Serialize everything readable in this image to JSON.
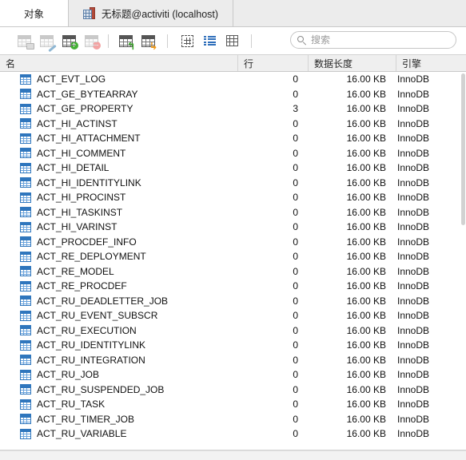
{
  "tabs": [
    {
      "label": "对象",
      "icon": "",
      "active": true
    },
    {
      "label": "无标题@activiti (localhost)",
      "icon": "database-icon",
      "active": false
    }
  ],
  "toolbar": {
    "buttons": [
      {
        "name": "open-table-button",
        "title": "打开表"
      },
      {
        "name": "design-table-button",
        "title": "设计表"
      },
      {
        "name": "new-table-button",
        "title": "新建表"
      },
      {
        "name": "delete-table-button",
        "title": "删除表"
      },
      {
        "name": "import-wizard-button",
        "title": "导入向导"
      },
      {
        "name": "export-wizard-button",
        "title": "导出向导"
      },
      {
        "name": "select-grid-button",
        "title": "网格"
      },
      {
        "name": "list-view-button",
        "title": "列表"
      },
      {
        "name": "detail-view-button",
        "title": "详细信息"
      }
    ]
  },
  "search": {
    "placeholder": "搜索",
    "value": ""
  },
  "table": {
    "columns": [
      {
        "key": "name",
        "label": "名"
      },
      {
        "key": "rows",
        "label": "行"
      },
      {
        "key": "length",
        "label": "数据长度"
      },
      {
        "key": "engine",
        "label": "引擎"
      }
    ],
    "rows": [
      {
        "name": "ACT_EVT_LOG",
        "rows": "0",
        "length": "16.00 KB",
        "engine": "InnoDB"
      },
      {
        "name": "ACT_GE_BYTEARRAY",
        "rows": "0",
        "length": "16.00 KB",
        "engine": "InnoDB"
      },
      {
        "name": "ACT_GE_PROPERTY",
        "rows": "3",
        "length": "16.00 KB",
        "engine": "InnoDB"
      },
      {
        "name": "ACT_HI_ACTINST",
        "rows": "0",
        "length": "16.00 KB",
        "engine": "InnoDB"
      },
      {
        "name": "ACT_HI_ATTACHMENT",
        "rows": "0",
        "length": "16.00 KB",
        "engine": "InnoDB"
      },
      {
        "name": "ACT_HI_COMMENT",
        "rows": "0",
        "length": "16.00 KB",
        "engine": "InnoDB"
      },
      {
        "name": "ACT_HI_DETAIL",
        "rows": "0",
        "length": "16.00 KB",
        "engine": "InnoDB"
      },
      {
        "name": "ACT_HI_IDENTITYLINK",
        "rows": "0",
        "length": "16.00 KB",
        "engine": "InnoDB"
      },
      {
        "name": "ACT_HI_PROCINST",
        "rows": "0",
        "length": "16.00 KB",
        "engine": "InnoDB"
      },
      {
        "name": "ACT_HI_TASKINST",
        "rows": "0",
        "length": "16.00 KB",
        "engine": "InnoDB"
      },
      {
        "name": "ACT_HI_VARINST",
        "rows": "0",
        "length": "16.00 KB",
        "engine": "InnoDB"
      },
      {
        "name": "ACT_PROCDEF_INFO",
        "rows": "0",
        "length": "16.00 KB",
        "engine": "InnoDB"
      },
      {
        "name": "ACT_RE_DEPLOYMENT",
        "rows": "0",
        "length": "16.00 KB",
        "engine": "InnoDB"
      },
      {
        "name": "ACT_RE_MODEL",
        "rows": "0",
        "length": "16.00 KB",
        "engine": "InnoDB"
      },
      {
        "name": "ACT_RE_PROCDEF",
        "rows": "0",
        "length": "16.00 KB",
        "engine": "InnoDB"
      },
      {
        "name": "ACT_RU_DEADLETTER_JOB",
        "rows": "0",
        "length": "16.00 KB",
        "engine": "InnoDB"
      },
      {
        "name": "ACT_RU_EVENT_SUBSCR",
        "rows": "0",
        "length": "16.00 KB",
        "engine": "InnoDB"
      },
      {
        "name": "ACT_RU_EXECUTION",
        "rows": "0",
        "length": "16.00 KB",
        "engine": "InnoDB"
      },
      {
        "name": "ACT_RU_IDENTITYLINK",
        "rows": "0",
        "length": "16.00 KB",
        "engine": "InnoDB"
      },
      {
        "name": "ACT_RU_INTEGRATION",
        "rows": "0",
        "length": "16.00 KB",
        "engine": "InnoDB"
      },
      {
        "name": "ACT_RU_JOB",
        "rows": "0",
        "length": "16.00 KB",
        "engine": "InnoDB"
      },
      {
        "name": "ACT_RU_SUSPENDED_JOB",
        "rows": "0",
        "length": "16.00 KB",
        "engine": "InnoDB"
      },
      {
        "name": "ACT_RU_TASK",
        "rows": "0",
        "length": "16.00 KB",
        "engine": "InnoDB"
      },
      {
        "name": "ACT_RU_TIMER_JOB",
        "rows": "0",
        "length": "16.00 KB",
        "engine": "InnoDB"
      },
      {
        "name": "ACT_RU_VARIABLE",
        "rows": "0",
        "length": "16.00 KB",
        "engine": "InnoDB"
      }
    ]
  },
  "colors": {
    "accent": "#2f76bd",
    "tabbar_bg": "#ececec",
    "header_bg": "#efefef",
    "add_green": "#45b036",
    "delete_red": "#f3a3a3",
    "export_orange": "#f39b16"
  }
}
